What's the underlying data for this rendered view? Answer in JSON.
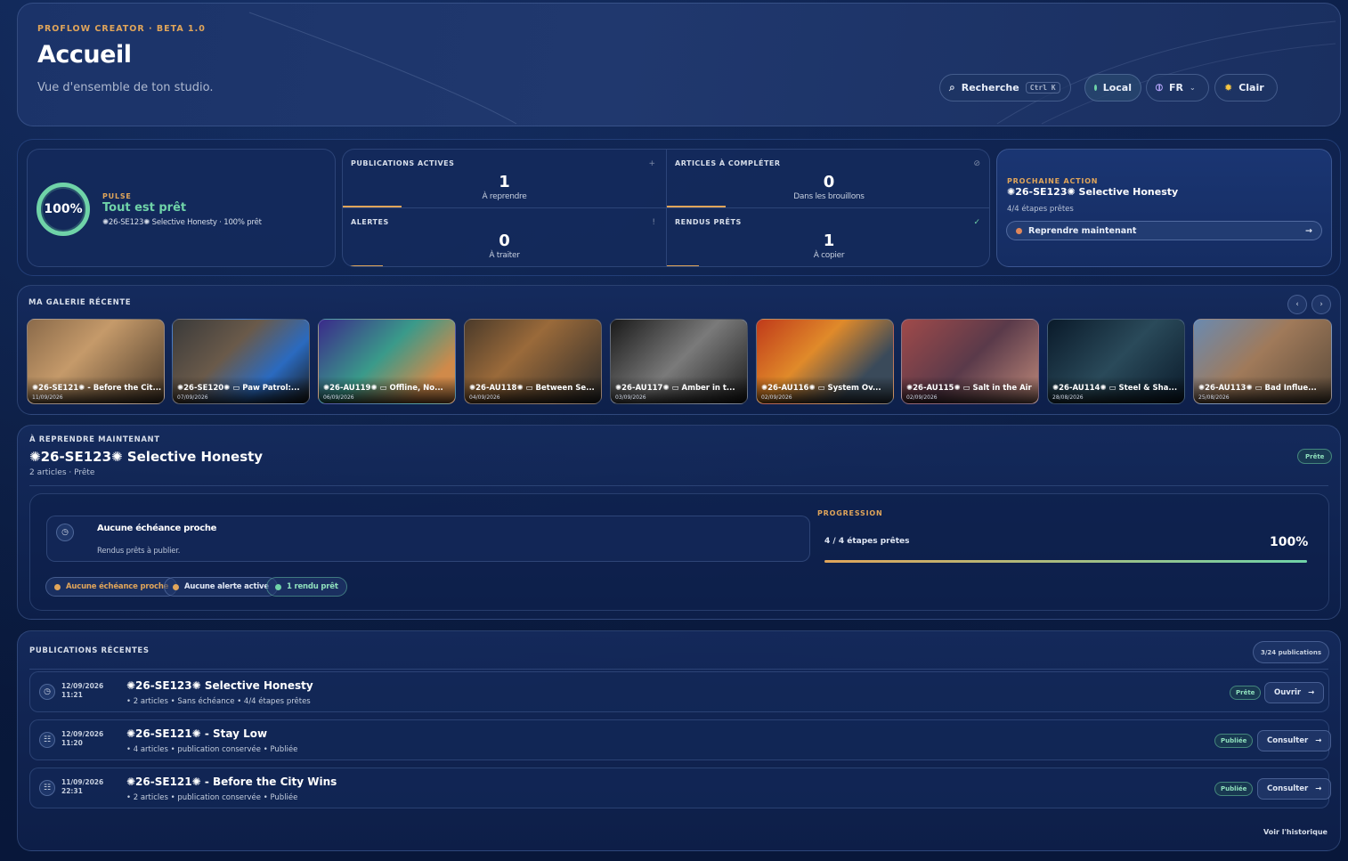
{
  "header": {
    "brand": "PROFLOW CREATOR · BETA 1.0",
    "title": "Accueil",
    "subtitle": "Vue d'ensemble de ton studio.",
    "search_label": "Recherche",
    "search_shortcut": "Ctrl K",
    "mode_label": "Local",
    "lang_label": "FR",
    "theme_label": "Clair"
  },
  "pulse": {
    "percent": "100%",
    "cap": "PULSE",
    "headline": "Tout est prêt",
    "detail": "✺26-SE123✺ Selective Honesty · 100% prêt"
  },
  "stats": [
    {
      "cap": "PUBLICATIONS ACTIVES",
      "icon": "+",
      "value": "1",
      "sub": "À reprendre"
    },
    {
      "cap": "ARTICLES À COMPLÉTER",
      "icon": "⊘",
      "value": "0",
      "sub": "Dans les brouillons"
    },
    {
      "cap": "ALERTES",
      "icon": "!",
      "value": "0",
      "sub": "À traiter"
    },
    {
      "cap": "RENDUS PRÊTS",
      "icon": "✓",
      "value": "1",
      "sub": "À copier"
    }
  ],
  "next_action": {
    "cap": "PROCHAINE ACTION",
    "title": "✺26-SE123✺ Selective Honesty",
    "meta": "4/4 étapes prêtes",
    "button": "Reprendre maintenant",
    "arrow": "→"
  },
  "gallery": {
    "title": "MA GALERIE RÉCENTE",
    "prev": "‹",
    "next": "›",
    "items": [
      {
        "title": "✺26-SE121✺ - Before the Cit...",
        "date": "11/09/2026"
      },
      {
        "title": "✺26-SE120✺ ▭ Paw Patrol:...",
        "date": "07/09/2026"
      },
      {
        "title": "✺26-AU119✺ ▭ Offline, No...",
        "date": "06/09/2026"
      },
      {
        "title": "✺26-AU118✺ ▭ Between Se...",
        "date": "04/09/2026"
      },
      {
        "title": "✺26-AU117✺ ▭ Amber in t...",
        "date": "03/09/2026"
      },
      {
        "title": "✺26-AU116✺ ▭ System Ov...",
        "date": "02/09/2026"
      },
      {
        "title": "✺26-AU115✺ ▭ Salt in the Air",
        "date": "02/09/2026"
      },
      {
        "title": "✺26-AU114✺ ▭ Steel & Sha...",
        "date": "28/08/2026"
      },
      {
        "title": "✺26-AU113✺ ▭ Bad Influe...",
        "date": "25/08/2026"
      }
    ]
  },
  "resume": {
    "cap": "À REPRENDRE MAINTENANT",
    "title": "✺26-SE123✺ Selective Honesty",
    "meta": "2 articles · Prête",
    "badge": "Prête",
    "due_title": "Aucune échéance proche",
    "due_sub": "Rendus prêts à publier.",
    "progress_cap": "PROGRESSION",
    "progress_text": "4 / 4 étapes prêtes",
    "progress_pct": "100%",
    "progress_value": 1.0,
    "chips": [
      "Aucune échéance proche",
      "Aucune alerte active",
      "1 rendu prêt"
    ]
  },
  "publications": {
    "title": "PUBLICATIONS RÉCENTES",
    "count": "3/24 publications",
    "history_link": "Voir l'historique",
    "rows": [
      {
        "icon": "◷",
        "date": "12/09/2026",
        "time": "11:21",
        "title": "✺26-SE123✺ Selective Honesty",
        "meta": [
          "2 articles",
          "Sans échéance",
          "4/4 étapes prêtes"
        ],
        "badge": "Prête",
        "button": "Ouvrir"
      },
      {
        "icon": "☷",
        "date": "12/09/2026",
        "time": "11:20",
        "title": "✺26-SE121✺ - Stay Low",
        "meta": [
          "4 articles",
          "publication conservée",
          "Publiée"
        ],
        "badge": "Publiée",
        "button": "Consulter"
      },
      {
        "icon": "☷",
        "date": "11/09/2026",
        "time": "22:31",
        "title": "✺26-SE121✺ - Before the City Wins",
        "meta": [
          "2 articles",
          "publication conservée",
          "Publiée"
        ],
        "badge": "Publiée",
        "button": "Consulter"
      }
    ]
  },
  "colors": {
    "accent": "#e0a55a",
    "success": "#6fd3a8",
    "background": "#0a1a3a"
  }
}
